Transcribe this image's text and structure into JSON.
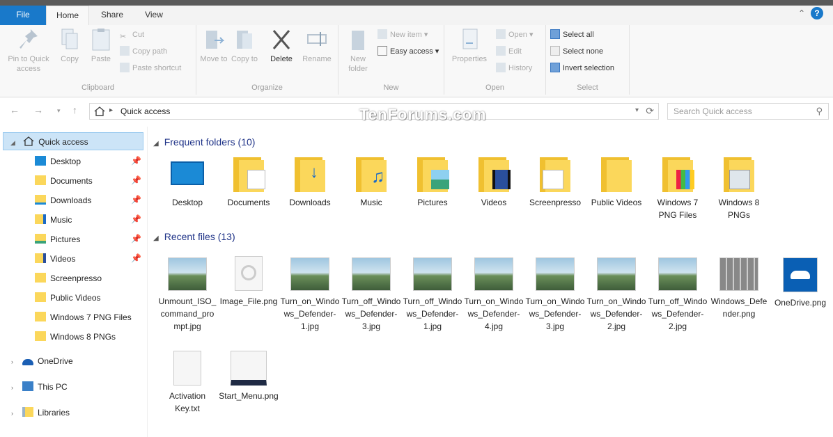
{
  "tabs": {
    "file": "File",
    "home": "Home",
    "share": "Share",
    "view": "View"
  },
  "ribbon": {
    "clipboard": {
      "label": "Clipboard",
      "pin": "Pin to Quick access",
      "copy": "Copy",
      "paste": "Paste",
      "cut": "Cut",
      "copy_path": "Copy path",
      "paste_shortcut": "Paste shortcut"
    },
    "organize": {
      "label": "Organize",
      "move_to": "Move to",
      "copy_to": "Copy to",
      "delete": "Delete",
      "rename": "Rename"
    },
    "new": {
      "label": "New",
      "new_folder": "New folder",
      "new_item": "New item",
      "easy_access": "Easy access"
    },
    "open": {
      "label": "Open",
      "properties": "Properties",
      "open": "Open",
      "edit": "Edit",
      "history": "History"
    },
    "select": {
      "label": "Select",
      "select_all": "Select all",
      "select_none": "Select none",
      "invert": "Invert selection"
    }
  },
  "address": {
    "path": "Quick access",
    "search_placeholder": "Search Quick access",
    "watermark": "TenForums.com"
  },
  "nav": {
    "quick_access": "Quick access",
    "pinned": [
      "Desktop",
      "Documents",
      "Downloads",
      "Music",
      "Pictures",
      "Videos"
    ],
    "recent": [
      "Screenpresso",
      "Public Videos",
      "Windows 7 PNG Files",
      "Windows 8 PNGs"
    ],
    "onedrive": "OneDrive",
    "this_pc": "This PC",
    "libraries": "Libraries"
  },
  "frequent": {
    "header": "Frequent folders (10)",
    "items": [
      "Desktop",
      "Documents",
      "Downloads",
      "Music",
      "Pictures",
      "Videos",
      "Screenpresso",
      "Public Videos",
      "Windows 7 PNG Files",
      "Windows 8 PNGs"
    ]
  },
  "recent": {
    "header": "Recent files (13)",
    "items": [
      "Unmount_ISO_command_prompt.jpg",
      "Image_File.png",
      "Turn_on_Windows_Defender-1.jpg",
      "Turn_off_Windows_Defender-3.jpg",
      "Turn_off_Windows_Defender-1.jpg",
      "Turn_on_Windows_Defender-4.jpg",
      "Turn_on_Windows_Defender-3.jpg",
      "Turn_on_Windows_Defender-2.jpg",
      "Turn_off_Windows_Defender-2.jpg",
      "Windows_Defender.png",
      "OneDrive.png",
      "Activation Key.txt",
      "Start_Menu.png"
    ]
  },
  "colors": {
    "accent": "#1979ca",
    "folder": "#fbd75b",
    "selection": "#cce4f7"
  }
}
